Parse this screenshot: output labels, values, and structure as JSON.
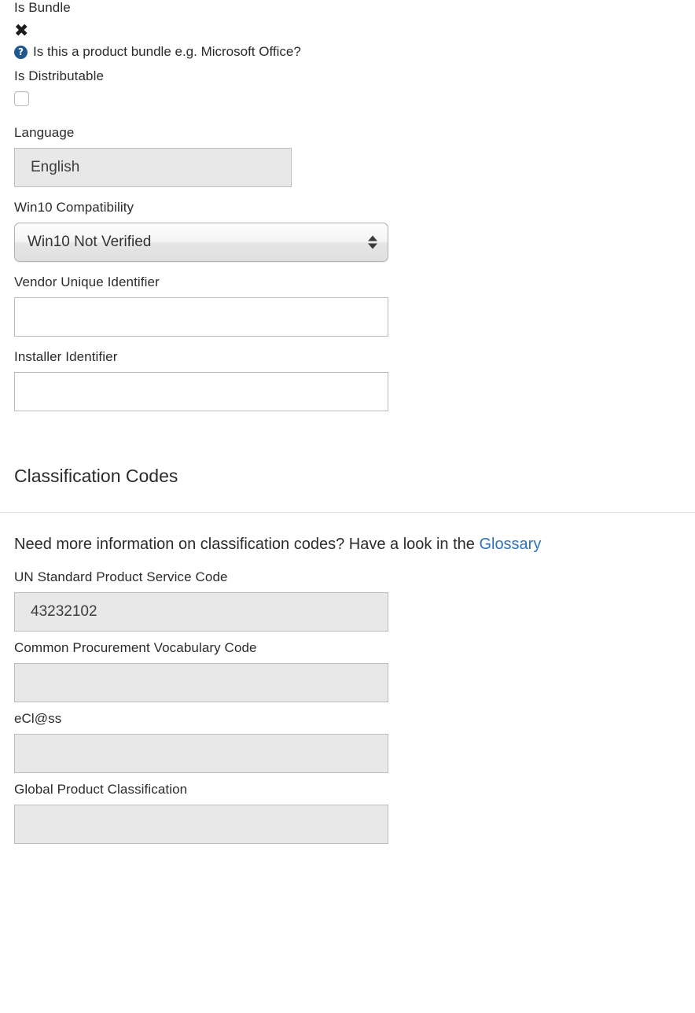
{
  "form": {
    "is_bundle": {
      "label": "Is Bundle",
      "value_icon": "✖",
      "icon_name": "cross-mark-icon",
      "help_badge": "?",
      "help_text": "Is this a product bundle e.g. Microsoft Office?"
    },
    "is_distributable": {
      "label": "Is Distributable",
      "checked": false
    },
    "language": {
      "label": "Language",
      "value": "English",
      "disabled": true
    },
    "win10_compatibility": {
      "label": "Win10 Compatibility",
      "selected": "Win10 Not Verified"
    },
    "vendor_unique_identifier": {
      "label": "Vendor Unique Identifier",
      "value": "",
      "placeholder": ""
    },
    "installer_identifier": {
      "label": "Installer Identifier",
      "value": "",
      "placeholder": ""
    }
  },
  "classification": {
    "heading": "Classification Codes",
    "info_prefix": "Need more information on classification codes? Have a look in the ",
    "info_link": "Glossary",
    "fields": [
      {
        "label": "UN Standard Product Service Code",
        "value": "43232102",
        "disabled": true
      },
      {
        "label": "Common Procurement Vocabulary Code",
        "value": "",
        "disabled": true
      },
      {
        "label": "eCl@ss",
        "value": "",
        "disabled": true
      },
      {
        "label": "Global Product Classification",
        "value": "",
        "disabled": true
      }
    ]
  },
  "colors": {
    "link": "#3071b4",
    "help_badge_bg": "#21578f",
    "disabled_bg": "#e8e8e8",
    "border": "#bdbdbd",
    "text": "#2b2b2b",
    "divider": "#e6e6e6"
  }
}
